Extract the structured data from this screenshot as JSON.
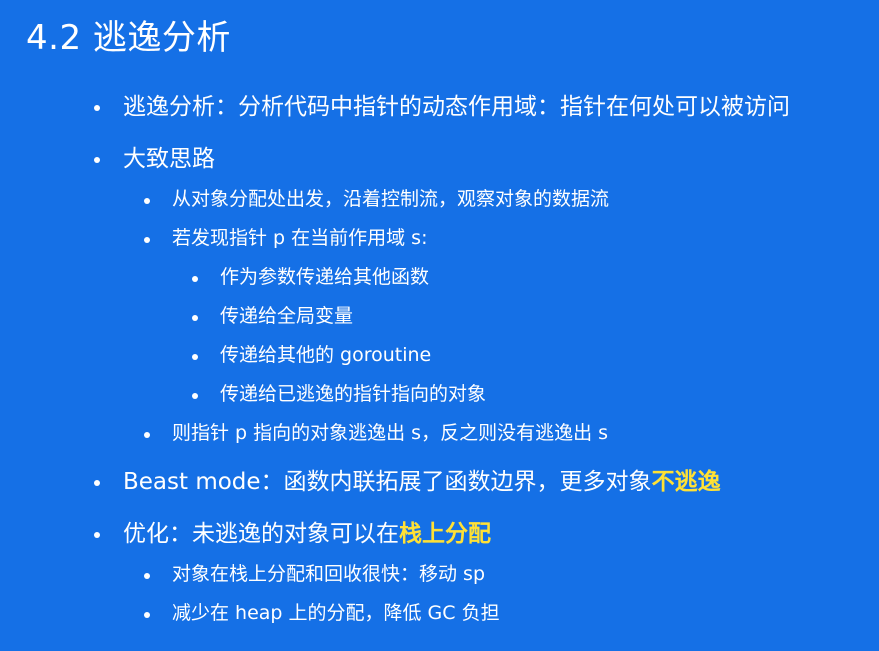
{
  "title": "4.2 逃逸分析",
  "items": [
    {
      "text": "逃逸分析：分析代码中指针的动态作用域：指针在何处可以被访问"
    },
    {
      "text": "大致思路"
    },
    {
      "text": "从对象分配处出发，沿着控制流，观察对象的数据流"
    },
    {
      "text": "若发现指针 p 在当前作用域 s:"
    },
    {
      "text": "作为参数传递给其他函数"
    },
    {
      "text": "传递给全局变量"
    },
    {
      "text": "传递给其他的 goroutine"
    },
    {
      "text": "传递给已逃逸的指针指向的对象"
    },
    {
      "text": "则指针 p 指向的对象逃逸出 s，反之则没有逃逸出 s"
    },
    {
      "text": "Beast mode：函数内联拓展了函数边界，更多对象",
      "highlight": "不逃逸"
    },
    {
      "text": "优化：未逃逸的对象可以在",
      "highlight": "栈上分配"
    },
    {
      "text": "对象在栈上分配和回收很快：移动 sp"
    },
    {
      "text": "减少在 heap 上的分配，降低 GC 负担"
    }
  ],
  "colors": {
    "background": "#1570e6",
    "text": "#ffffff",
    "highlight": "#ffe135"
  }
}
